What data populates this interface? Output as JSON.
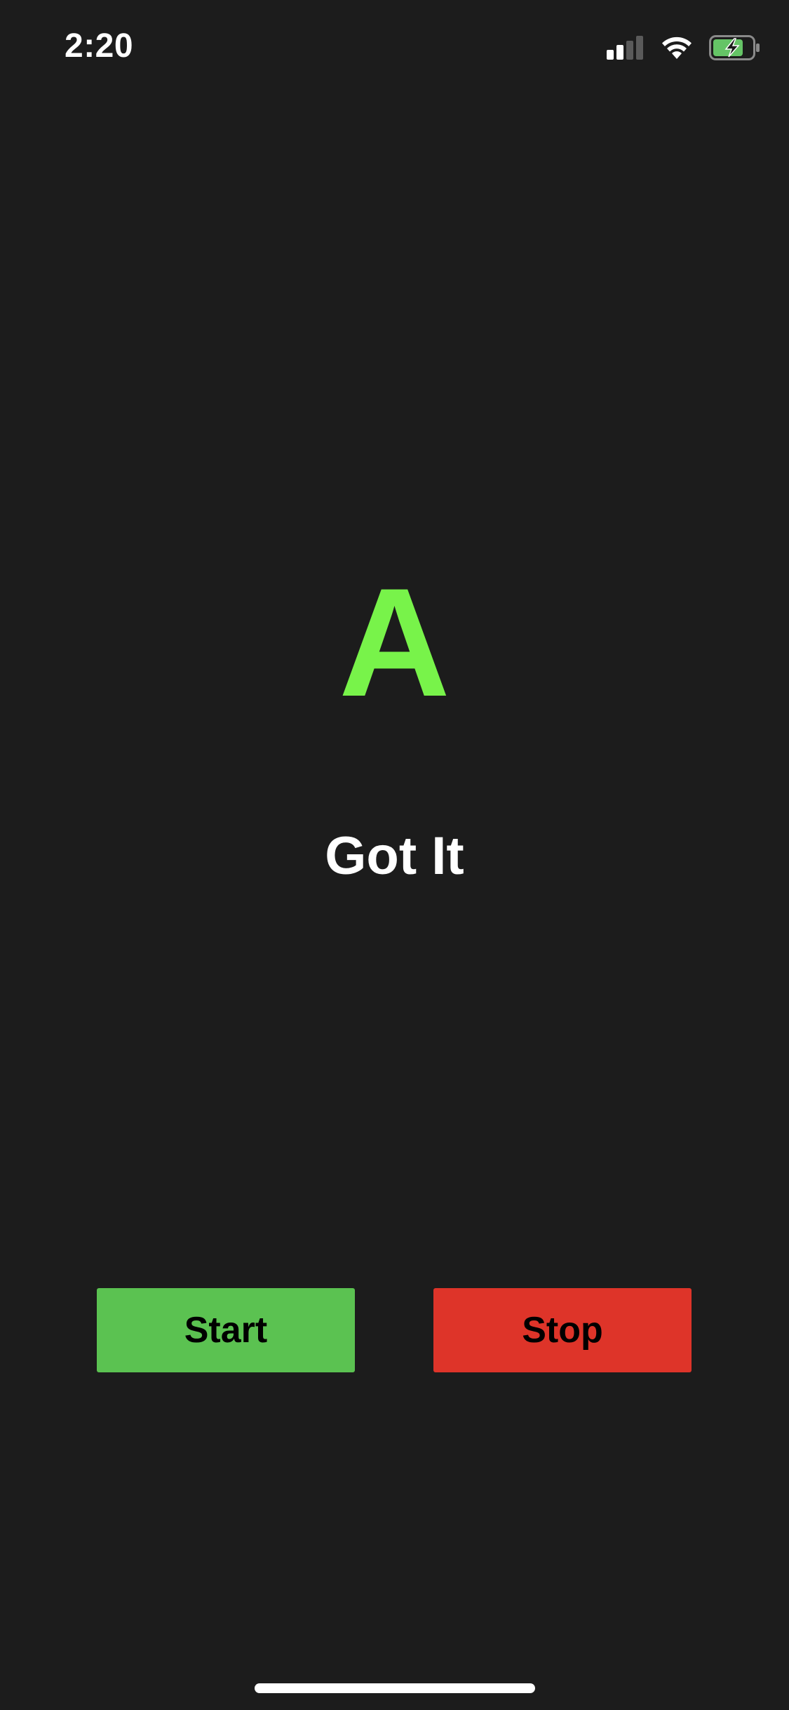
{
  "status_bar": {
    "time": "2:20",
    "signal_icon": "signal-strength-icon",
    "wifi_icon": "wifi-icon",
    "battery_icon": "battery-charging-icon",
    "battery_color": "#65c466"
  },
  "main": {
    "letter": "A",
    "letter_color": "#78f34a",
    "feedback": "Got It"
  },
  "controls": {
    "start_label": "Start",
    "start_color": "#5bc251",
    "stop_label": "Stop",
    "stop_color": "#de3429"
  },
  "colors": {
    "background": "#1c1c1c"
  }
}
